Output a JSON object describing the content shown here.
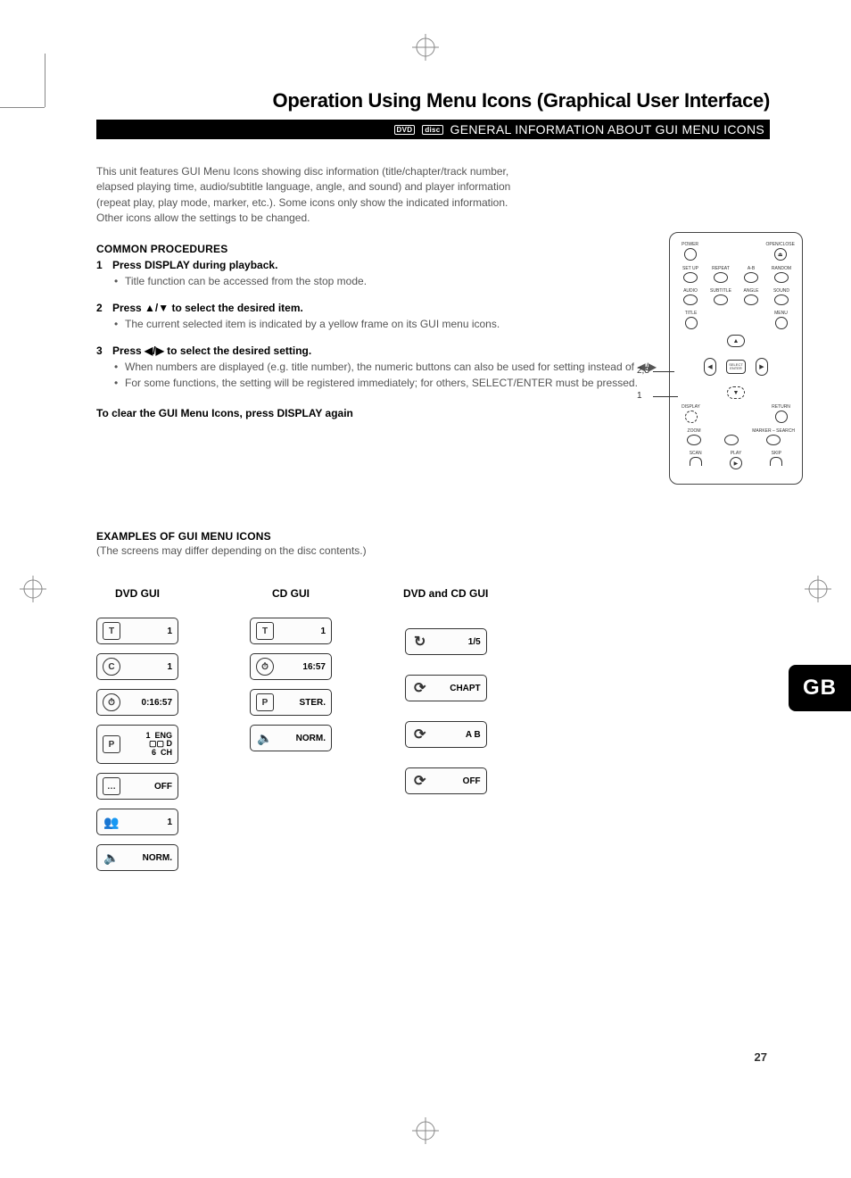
{
  "title": "Operation Using Menu Icons (Graphical User Interface)",
  "bar": {
    "logos": [
      "DVD",
      "disc"
    ],
    "text": "GENERAL INFORMATION ABOUT GUI MENU ICONS"
  },
  "intro": "This unit features GUI Menu Icons showing disc information (title/chapter/track number, elapsed playing time, audio/subtitle language, angle, and sound) and player information (repeat play, play mode, marker, etc.). Some icons only show the indicated information. Other icons allow the settings to be changed.",
  "common": {
    "heading": "COMMON PROCEDURES",
    "steps": [
      {
        "num": "1",
        "head": "Press DISPLAY during playback.",
        "bullets": [
          "Title function can be accessed from the stop mode."
        ]
      },
      {
        "num": "2",
        "head_pre": "Press ",
        "head_sym": "▲/▼",
        "head_post": " to select the desired item.",
        "bullets": [
          "The current selected item is indicated by a yellow frame on its GUI menu icons."
        ]
      },
      {
        "num": "3",
        "head_pre": "Press ",
        "head_sym": "◀/▶",
        "head_post": " to select the desired setting.",
        "bullets": [
          "When numbers are displayed (e.g. title number), the numeric buttons can also be used for setting instead of  ◀/▶",
          "For some functions, the setting will be registered immediately; for others, SELECT/ENTER must be pressed."
        ]
      }
    ],
    "clear": "To clear the GUI Menu Icons, press DISPLAY again"
  },
  "remote": {
    "row1": [
      {
        "label": "POWER"
      },
      {
        "label": ""
      },
      {
        "label": ""
      },
      {
        "label": "OPEN/CLOSE",
        "sym": "⏏"
      }
    ],
    "row2": [
      {
        "label": "SET UP"
      },
      {
        "label": "REPEAT"
      },
      {
        "label": "A-B"
      },
      {
        "label": "RANDOM"
      }
    ],
    "row3": [
      {
        "label": "AUDIO"
      },
      {
        "label": "SUBTITLE"
      },
      {
        "label": "ANGLE"
      },
      {
        "label": "SOUND"
      }
    ],
    "title_menu": {
      "left": "TITLE",
      "right": "MENU"
    },
    "center": "SELECT ENTER",
    "display_return": {
      "left": "DISPLAY",
      "right": "RETURN"
    },
    "row_zoom": [
      {
        "label": "ZOOM"
      },
      {
        "label": ""
      },
      {
        "label": "MARKER – SEARCH"
      }
    ],
    "row_play": [
      {
        "label": "SCAN"
      },
      {
        "label": "PLAY",
        "sym": "▶"
      },
      {
        "label": "SKIP"
      }
    ],
    "callout1": "2,3",
    "callout2": "1"
  },
  "examples": {
    "heading": "EXAMPLES OF GUI MENU ICONS",
    "note": "(The screens may differ depending on the disc contents.)",
    "cols": {
      "dvd": {
        "title": "DVD GUI",
        "items": [
          {
            "icon": "T",
            "val": "1"
          },
          {
            "icon": "C",
            "val": "1",
            "round": true
          },
          {
            "icon": "⏱",
            "val": "0:16:57",
            "round": true
          },
          {
            "icon": "P",
            "val": "1  ENG\n▢▢ D\n6  CH",
            "tall": true
          },
          {
            "icon": "…",
            "val": "OFF"
          },
          {
            "icon": "👥",
            "val": "1"
          },
          {
            "icon": "🔈",
            "val": "NORM."
          }
        ]
      },
      "cd": {
        "title": "CD GUI",
        "items": [
          {
            "icon": "T",
            "val": "1"
          },
          {
            "icon": "⏱",
            "val": "16:57",
            "round": true
          },
          {
            "icon": "P",
            "val": "STER."
          },
          {
            "icon": "🔈",
            "val": "NORM."
          }
        ]
      },
      "both": {
        "title": "DVD and CD GUI",
        "items": [
          {
            "icon": "↻",
            "val": "1/5",
            "round": true
          },
          {
            "icon": "⟳",
            "val": "CHAPT"
          },
          {
            "icon": "⟳",
            "val": "A   B"
          },
          {
            "icon": "⟳",
            "val": "OFF"
          }
        ]
      }
    }
  },
  "side_tab": "GB",
  "page_number": "27"
}
